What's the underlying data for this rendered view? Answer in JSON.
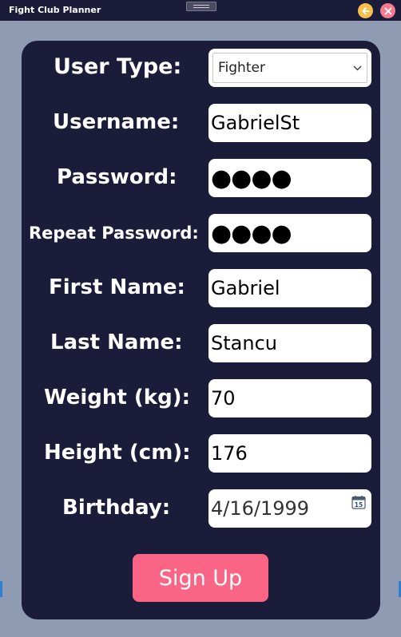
{
  "window": {
    "title": "Fight Club Planner"
  },
  "form": {
    "user_type": {
      "label": "User Type:",
      "value": "Fighter"
    },
    "username": {
      "label": "Username:",
      "value": "GabrielSt"
    },
    "password": {
      "label": "Password:",
      "value": "●●●●"
    },
    "repeat_password": {
      "label": "Repeat Password:",
      "value": "●●●●"
    },
    "first_name": {
      "label": "First Name:",
      "value": "Gabriel"
    },
    "last_name": {
      "label": "Last Name:",
      "value": "Stancu"
    },
    "weight": {
      "label": "Weight (kg):",
      "value": "70"
    },
    "height": {
      "label": "Height (cm):",
      "value": "176"
    },
    "birthday": {
      "label": "Birthday:",
      "value": "4/16/1999"
    },
    "submit_label": "Sign Up"
  },
  "icons": {
    "minimize": "back-arrow-icon",
    "close": "close-icon",
    "dropdown": "chevron-down-icon",
    "calendar": "calendar-icon",
    "calendar_day": "15"
  },
  "colors": {
    "background": "#8e9bb3",
    "panel": "#1b1b3a",
    "accent": "#fb6585",
    "minimize_button": "#f6c14b",
    "close_button": "#f47a8e"
  }
}
